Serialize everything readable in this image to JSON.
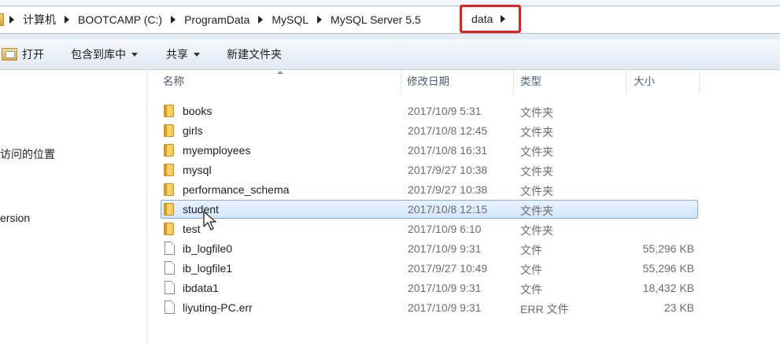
{
  "address": {
    "crumbs": [
      "计算机",
      "BOOTCAMP (C:)",
      "ProgramData",
      "MySQL",
      "MySQL Server 5.5"
    ],
    "current": "data"
  },
  "toolbar": {
    "open": "打开",
    "include_library": "包含到库中",
    "share": "共享",
    "new_folder": "新建文件夹"
  },
  "nav": {
    "recent_places": "访问的位置",
    "version": "ersion"
  },
  "columns": {
    "name": "名称",
    "date": "修改日期",
    "type": "类型",
    "size": "大小"
  },
  "files": [
    {
      "name": "books",
      "date": "2017/10/9 5:31",
      "type": "文件夹",
      "size": "",
      "kind": "folder"
    },
    {
      "name": "girls",
      "date": "2017/10/8 12:45",
      "type": "文件夹",
      "size": "",
      "kind": "folder"
    },
    {
      "name": "myemployees",
      "date": "2017/10/8 16:31",
      "type": "文件夹",
      "size": "",
      "kind": "folder"
    },
    {
      "name": "mysql",
      "date": "2017/9/27 10:38",
      "type": "文件夹",
      "size": "",
      "kind": "folder"
    },
    {
      "name": "performance_schema",
      "date": "2017/9/27 10:38",
      "type": "文件夹",
      "size": "",
      "kind": "folder"
    },
    {
      "name": "student",
      "date": "2017/10/8 12:15",
      "type": "文件夹",
      "size": "",
      "kind": "folder",
      "selected": true
    },
    {
      "name": "test",
      "date": "2017/10/9 6:10",
      "type": "文件夹",
      "size": "",
      "kind": "folder"
    },
    {
      "name": "ib_logfile0",
      "date": "2017/10/9 9:31",
      "type": "文件",
      "size": "55,296 KB",
      "kind": "file"
    },
    {
      "name": "ib_logfile1",
      "date": "2017/9/27 10:49",
      "type": "文件",
      "size": "55,296 KB",
      "kind": "file"
    },
    {
      "name": "ibdata1",
      "date": "2017/10/9 9:31",
      "type": "文件",
      "size": "18,432 KB",
      "kind": "file"
    },
    {
      "name": "liyuting-PC.err",
      "date": "2017/10/9 9:31",
      "type": "ERR 文件",
      "size": "23 KB",
      "kind": "file"
    }
  ],
  "colors": {
    "highlight_border": "#e32020",
    "selection_border": "#84acdd"
  }
}
